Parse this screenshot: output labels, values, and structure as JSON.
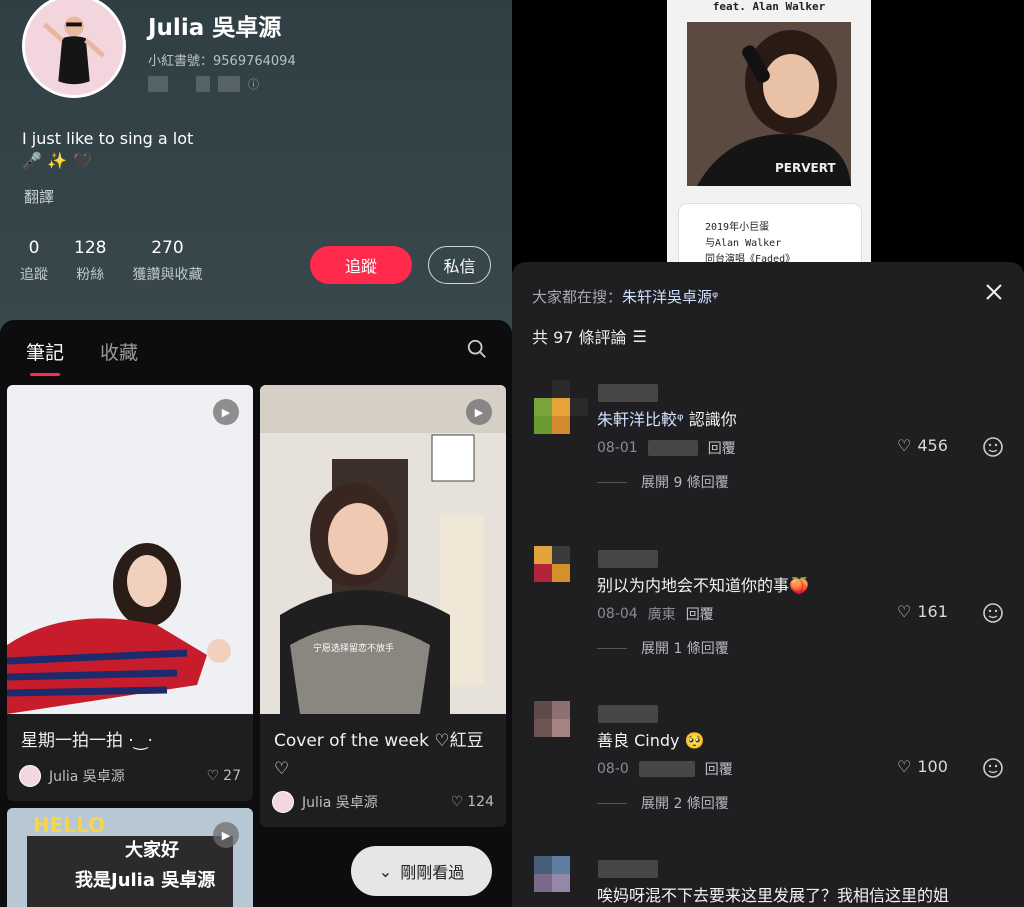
{
  "profile": {
    "name": "Julia 吳卓源",
    "red_id": "小紅書號：9569764094",
    "bio_line1": "I just like to sing a lot",
    "bio_line2": "🎤 ✨ 🖤",
    "translate": "翻譯",
    "stats": [
      {
        "value": "0",
        "label": "追蹤"
      },
      {
        "value": "128",
        "label": "粉絲"
      },
      {
        "value": "270",
        "label": "獲讚與收藏"
      }
    ],
    "follow_label": "追蹤",
    "dm_label": "私信"
  },
  "feed": {
    "tabs": [
      "筆記",
      "收藏"
    ],
    "cards": [
      {
        "title": "星期一拍一拍 ·‿·",
        "author": "Julia 吳卓源",
        "likes": "27"
      },
      {
        "title": "Cover of the week ♡紅豆",
        "title2": "♡",
        "author": "Julia 吳卓源",
        "likes": "124",
        "subtitle_in_image": "宁愿选择留恋不放手"
      },
      {
        "hello": "HELLO",
        "line1": "大家好",
        "line2": "我是Julia 吳卓源"
      }
    ],
    "recent_label": "剛剛看過"
  },
  "poster": {
    "feat": "feat. Alan Walker",
    "note_lines": [
      "2019年小巨蛋",
      "与Alan Walker",
      "同台演唱《Faded》"
    ],
    "shirt_text": "PERVERT"
  },
  "comments_sheet": {
    "search_prefix": "大家都在搜：",
    "search_keyword": "朱轩洋吳卓源",
    "count_label": "共 97 條評論",
    "comments": [
      {
        "text_kw": "朱軒洋比較",
        "text": " 認識你",
        "date": "08-01",
        "location": "",
        "reply": "回覆",
        "likes": "456",
        "expand": "展開 9 條回覆"
      },
      {
        "text_kw": "",
        "text": "别以为内地会不知道你的事🍑",
        "date": "08-04",
        "location": "廣東",
        "reply": "回覆",
        "likes": "161",
        "expand": "展開 1 條回覆"
      },
      {
        "text_kw": "",
        "text": "善良 Cindy 🥺",
        "date": "08-0",
        "location": "",
        "reply": "回覆",
        "likes": "100",
        "expand": "展開 2 條回覆"
      },
      {
        "text_kw": "",
        "text": "唉妈呀混不下去要来这里发展了？我相信这里的姐",
        "date": "",
        "location": "",
        "reply": "",
        "likes": "",
        "expand": ""
      }
    ]
  }
}
